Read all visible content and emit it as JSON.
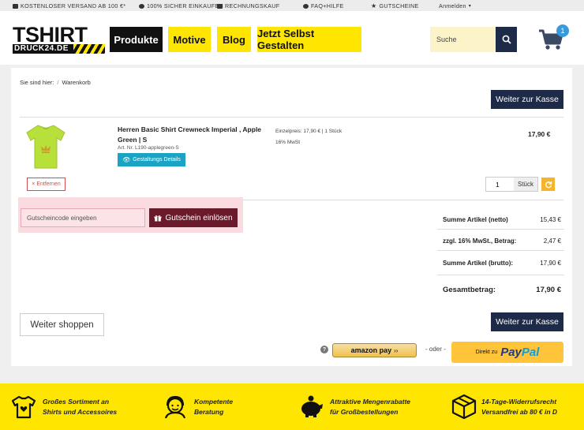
{
  "topbar": {
    "items": [
      "KOSTENLOSER VERSAND AB 100 €*",
      "100% SICHER EINKAUFEN",
      "RECHNUNGSKAUF",
      "FAQ+HILFE",
      "GUTSCHEINE"
    ],
    "login": "Anmelden"
  },
  "header": {
    "logo_top": "TSHIRT",
    "logo_bottom": "DRUCK24.DE",
    "nav": [
      "Produkte",
      "Motive",
      "Blog",
      "Jetzt Selbst Gestalten"
    ],
    "search_placeholder": "Suche",
    "cart_count": "1"
  },
  "breadcrumb": {
    "prefix": "Sie sind hier:",
    "sep": "/",
    "current": "Warenkorb"
  },
  "checkout_label": "Weiter zur Kasse",
  "item": {
    "title": "Herren Basic Shirt Crewneck Imperial , Apple Green | S",
    "article": "Art. Nr. L190-applegreen-S",
    "design_details": "Gestaltungs Details",
    "unit_price": "Einzelpreis: 17,90 € | 1 Stück",
    "vat": "16% MwSt",
    "price": "17,90 €",
    "remove": "Entfernen",
    "quantity": "1",
    "quantity_unit": "Stück",
    "shirt_color": "#b7e03a"
  },
  "coupon": {
    "placeholder": "Gutscheincode eingeben",
    "button": "Gutschein einlösen"
  },
  "summary": [
    {
      "label": "Summe Artikel (netto)",
      "value": "15,43 €"
    },
    {
      "label": "zzgl. 16% MwSt., Betrag:",
      "value": "2,47 €"
    },
    {
      "label": "Summe Artikel (brutto):",
      "value": "17,90 €"
    }
  ],
  "total": {
    "label": "Gesamtbetrag:",
    "value": "17,90 €"
  },
  "continue_shopping": "Weiter shoppen",
  "help_icon": "?",
  "amazon_pay": "amazon pay",
  "or": "- oder -",
  "paypal": {
    "prefix": "Direkt zu",
    "brand1": "Pay",
    "brand2": "Pal"
  },
  "footer": [
    {
      "line1": "Großes Sortiment an",
      "line2": "Shirts und Accessoires",
      "icon": "shirt-heart-icon"
    },
    {
      "line1": "Kompetente",
      "line2": "Beratung",
      "icon": "support-agent-icon"
    },
    {
      "line1": "Attraktive Mengenrabatte",
      "line2": "für Großbestellungen",
      "icon": "piggy-bank-icon"
    },
    {
      "line1": "14-Tage-Widerrufsrecht",
      "line2": "Versandfrei ab 80 € in D",
      "icon": "package-icon"
    }
  ],
  "colors": {
    "navy": "#1d2a48",
    "yellow": "#ffe600",
    "coupon_bg": "#fadbe0",
    "coupon_btn": "#6a1a2a",
    "teal": "#1aa3c2"
  }
}
